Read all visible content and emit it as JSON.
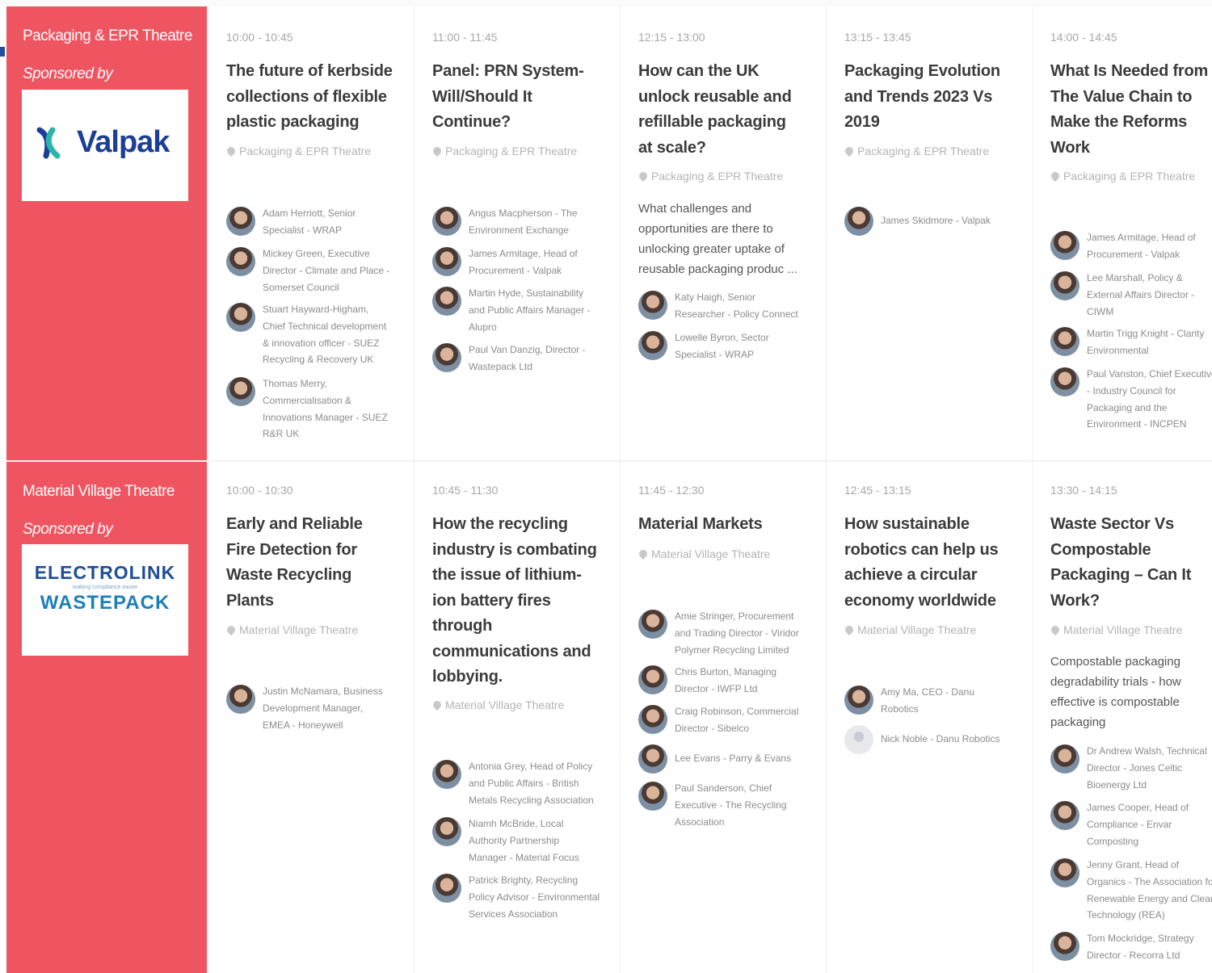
{
  "colors": {
    "theatre_panel": "#ef5461",
    "title": "#3b3b3b",
    "muted": "#a8a8a8"
  },
  "rows": [
    {
      "theatre_name": "Packaging & EPR Theatre",
      "sponsored_by": "Sponsored by",
      "sponsor": {
        "name": "Valpak",
        "icon": "valpak-logo-icon"
      },
      "sessions": [
        {
          "time": "10:00 - 10:45",
          "title_lines": [
            "The future of kerbside",
            "collections of flexible",
            "plastic packaging"
          ],
          "venue": "Packaging & EPR Theatre",
          "speakers": [
            {
              "lines": [
                "Adam Herriott, Senior",
                "Specialist - WRAP"
              ]
            },
            {
              "lines": [
                "Mickey Green, Executive",
                "Director - Climate and Place -",
                "Somerset Council"
              ]
            },
            {
              "lines": [
                "Stuart Hayward-Higham,",
                "Chief Technical development",
                "& innovation officer - SUEZ",
                "Recycling & Recovery UK"
              ]
            },
            {
              "lines": [
                "Thomas Merry,",
                "Commercialisation &",
                "Innovations Manager - SUEZ",
                "R&R UK"
              ]
            }
          ]
        },
        {
          "time": "11:00 - 11:45",
          "title_lines": [
            "Panel: PRN System-",
            "Will/Should It",
            "Continue?"
          ],
          "venue": "Packaging & EPR Theatre",
          "speakers": [
            {
              "lines": [
                "Angus Macpherson - The",
                "Environment Exchange"
              ]
            },
            {
              "lines": [
                "James Armitage, Head of",
                "Procurement - Valpak"
              ]
            },
            {
              "lines": [
                "Martin Hyde, Sustainability",
                "and Public Affairs Manager -",
                "Alupro"
              ]
            },
            {
              "lines": [
                "Paul Van Danzig, Director -",
                "Wastepack Ltd"
              ]
            }
          ]
        },
        {
          "time": "12:15 - 13:00",
          "title_lines": [
            "How can the UK",
            "unlock reusable and",
            "refillable packaging",
            "at scale?"
          ],
          "venue": "Packaging & EPR Theatre",
          "desc_lines": [
            "What challenges and",
            "opportunities are there to",
            "unlocking greater uptake of",
            "reusable packaging produc ..."
          ],
          "speakers": [
            {
              "lines": [
                "Katy Haigh, Senior",
                "Researcher - Policy Connect"
              ]
            },
            {
              "lines": [
                "Lowelle Byron, Sector",
                "Specialist - WRAP"
              ]
            }
          ]
        },
        {
          "time": "13:15 - 13:45",
          "title_lines": [
            "Packaging Evolution",
            "and Trends 2023 Vs",
            "2019"
          ],
          "venue": "Packaging & EPR Theatre",
          "speakers": [
            {
              "lines": [
                "James Skidmore - Valpak"
              ]
            }
          ]
        },
        {
          "time": "14:00 - 14:45",
          "title_lines": [
            "What Is Needed from",
            "The Value Chain to",
            "Make the Reforms",
            "Work"
          ],
          "venue": "Packaging & EPR Theatre",
          "speakers": [
            {
              "lines": [
                "James Armitage, Head of",
                "Procurement - Valpak"
              ]
            },
            {
              "lines": [
                "Lee Marshall, Policy &",
                "External Affairs Director -",
                "CIWM"
              ]
            },
            {
              "lines": [
                "Martin Trigg Knight - Clarity",
                "Environmental"
              ]
            },
            {
              "lines": [
                "Paul Vanston, Chief Executive",
                "- Industry Council for",
                "Packaging and the",
                "Environment - INCPEN"
              ]
            }
          ]
        }
      ]
    },
    {
      "theatre_name": "Material Village Theatre",
      "sponsored_by": "Sponsored by",
      "sponsor": {
        "name_top": "ELECTROLINK",
        "tagline": "making compliance easier",
        "name_bottom": "WASTEPACK",
        "icon": "electrolink-wastepack-logo-icon"
      },
      "sessions": [
        {
          "time": "10:00 - 10:30",
          "title_lines": [
            "Early and Reliable",
            "Fire Detection for",
            "Waste Recycling",
            "Plants"
          ],
          "venue": "Material Village Theatre",
          "speakers": [
            {
              "lines": [
                "Justin McNamara, Business",
                "Development Manager,",
                "EMEA - Honeywell"
              ]
            }
          ]
        },
        {
          "time": "10:45 - 11:30",
          "title_lines": [
            "How the recycling",
            "industry is combating",
            "the issue of lithium-",
            "ion battery fires",
            "through",
            "communications and",
            "lobbying."
          ],
          "venue": "Material Village Theatre",
          "speakers": [
            {
              "lines": [
                "Antonia Grey, Head of Policy",
                "and Public Affairs - British",
                "Metals Recycling Association"
              ]
            },
            {
              "lines": [
                "Niamh McBride, Local",
                "Authority Partnership",
                "Manager - Material Focus"
              ]
            },
            {
              "lines": [
                "Patrick Brighty, Recycling",
                "Policy Advisor - Environmental",
                "Services Association"
              ]
            }
          ]
        },
        {
          "time": "11:45 - 12:30",
          "title_lines": [
            "Material Markets"
          ],
          "venue": "Material Village Theatre",
          "speakers": [
            {
              "lines": [
                "Amie Stringer, Procurement",
                "and Trading Director - Viridor",
                "Polymer Recycling Limited"
              ]
            },
            {
              "lines": [
                "Chris Burton, Managing",
                "Director - IWFP Ltd"
              ]
            },
            {
              "lines": [
                "Craig Robinson, Commercial",
                "Director - Sibelco"
              ]
            },
            {
              "lines": [
                "Lee Evans - Parry & Evans"
              ]
            },
            {
              "lines": [
                "Paul Sanderson, Chief",
                "Executive - The Recycling",
                "Association"
              ]
            }
          ]
        },
        {
          "time": "12:45 - 13:15",
          "title_lines": [
            "How sustainable",
            "robotics can help us",
            "achieve a circular",
            "economy worldwide"
          ],
          "venue": "Material Village Theatre",
          "speakers": [
            {
              "lines": [
                "Amy Ma, CEO - Danu",
                "Robotics"
              ]
            },
            {
              "lines": [
                "Nick Noble - Danu Robotics"
              ]
            }
          ]
        },
        {
          "time": "13:30 - 14:15",
          "title_lines": [
            "Waste Sector Vs",
            "Compostable",
            "Packaging – Can It",
            "Work?"
          ],
          "venue": "Material Village Theatre",
          "desc_lines": [
            "Compostable packaging",
            "degradability trials - how",
            "effective is compostable",
            "packaging"
          ],
          "speakers": [
            {
              "lines": [
                "Dr Andrew Walsh, Technical",
                "Director - Jones Celtic",
                "Bioenergy Ltd"
              ]
            },
            {
              "lines": [
                "James Cooper, Head of",
                "Compliance - Envar",
                "Composting"
              ]
            },
            {
              "lines": [
                "Jenny Grant, Head of",
                "Organics - The Association for",
                "Renewable Energy and Clean",
                "Technology (REA)"
              ]
            },
            {
              "lines": [
                "Tom Mockridge, Strategy",
                "Director - Recorra Ltd"
              ]
            }
          ]
        }
      ]
    }
  ]
}
